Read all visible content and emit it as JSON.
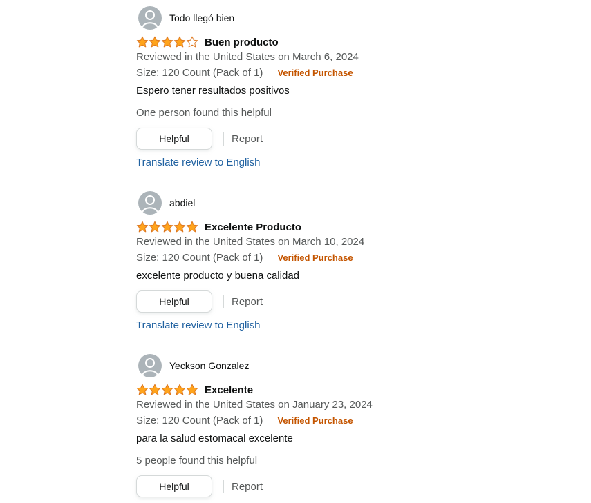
{
  "colors": {
    "star_fill": "#ffa41c",
    "star_stroke": "#de7921",
    "verified": "#c45500",
    "link": "#2162a1",
    "secondary_text": "#565959",
    "avatar_bg": "#acb4b9"
  },
  "reviews": [
    {
      "profile_name": "Todo llegó bien",
      "rating": 4,
      "title": "Buen producto",
      "date": "Reviewed in the United States on March 6, 2024",
      "size": "Size: 120 Count (Pack of 1)",
      "verified": "Verified Purchase",
      "body": "Espero tener resultados positivos",
      "helpful_count": "One person found this helpful",
      "helpful_label": "Helpful",
      "report_label": "Report",
      "translate_label": "Translate review to English"
    },
    {
      "profile_name": "abdiel",
      "rating": 5,
      "title": "Excelente Producto",
      "date": "Reviewed in the United States on March 10, 2024",
      "size": "Size: 120 Count (Pack of 1)",
      "verified": "Verified Purchase",
      "body": "excelente producto y buena calidad",
      "helpful_label": "Helpful",
      "report_label": "Report",
      "translate_label": "Translate review to English"
    },
    {
      "profile_name": "Yeckson Gonzalez",
      "rating": 5,
      "title": "Excelente",
      "date": "Reviewed in the United States on January 23, 2024",
      "size": "Size: 120 Count (Pack of 1)",
      "verified": "Verified Purchase",
      "body": "para la salud estomacal excelente",
      "helpful_count": "5 people found this helpful",
      "helpful_label": "Helpful",
      "report_label": "Report"
    }
  ],
  "icons": {
    "avatar": "avatar-icon",
    "star_full": "star-full-icon",
    "star_empty": "star-empty-icon"
  }
}
